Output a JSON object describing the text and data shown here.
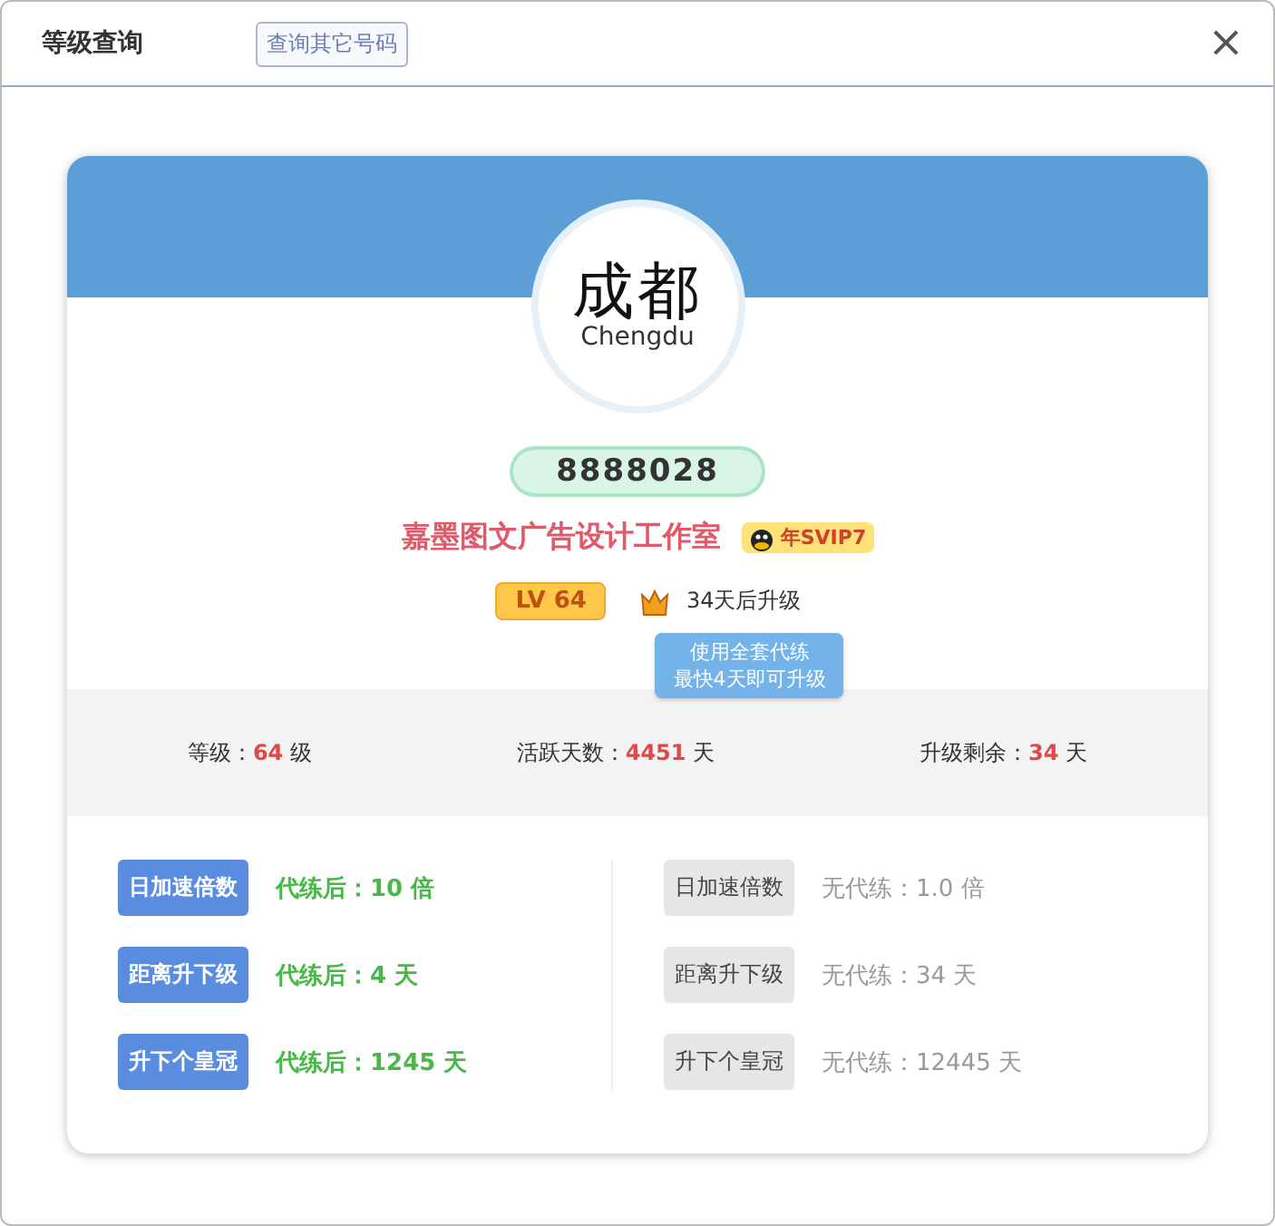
{
  "dialog": {
    "title": "等级查询",
    "query_button": "查询其它号码",
    "close": "×"
  },
  "profile": {
    "avatar_text": "成都",
    "avatar_subtext": "Chengdu",
    "number": "8888028",
    "name": "嘉墨图文广告设计工作室",
    "vip_badge": "年SVIP7",
    "level_badge": "LV 64",
    "upgrade_text": "34天后升级",
    "tooltip": [
      "使用全套代练",
      "最快4天即可升级"
    ]
  },
  "stats": [
    {
      "label": "等级：",
      "value": "64",
      "unit": " 级"
    },
    {
      "label": "活跃天数：",
      "value": "4451",
      "unit": " 天"
    },
    {
      "label": "升级剩余：",
      "value": "34",
      "unit": " 天"
    }
  ],
  "columns": [
    {
      "kind": "with_service",
      "rows": [
        {
          "label": "日加速倍数",
          "value": "代练后：10 倍"
        },
        {
          "label": "距离升下级",
          "value": "代练后：4 天"
        },
        {
          "label": "升下个皇冠",
          "value": "代练后：1245 天"
        }
      ]
    },
    {
      "kind": "without_service",
      "rows": [
        {
          "label": "日加速倍数",
          "value": "无代练：1.0 倍"
        },
        {
          "label": "距离升下级",
          "value": "无代练：34 天"
        },
        {
          "label": "升下个皇冠",
          "value": "无代练：12445 天"
        }
      ]
    }
  ]
}
